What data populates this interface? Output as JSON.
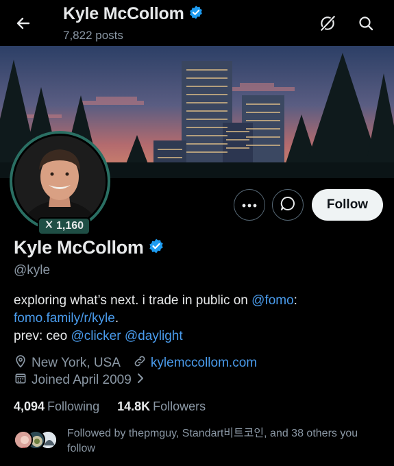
{
  "header": {
    "name": "Kyle McCollom",
    "posts": "7,822 posts",
    "back_icon": "arrow-left-icon",
    "grok_icon": "grok-icon",
    "search_icon": "search-icon"
  },
  "profile": {
    "affiliate_count": "1,160",
    "name": "Kyle McCollom",
    "handle": "@kyle",
    "verified": true,
    "accent_color": "#1d9bf0"
  },
  "actions": {
    "more_icon": "more-icon",
    "message_icon": "message-icon",
    "follow_label": "Follow"
  },
  "bio": {
    "line1_text": "exploring what’s next. i trade in public on ",
    "line1_mention": "@fomo",
    "line1_suffix": ":",
    "line2_link": "fomo.family/r/kyle",
    "line2_suffix": ".",
    "line3_text": "prev: ceo ",
    "line3_mention1": "@clicker",
    "line3_mention2": "@daylight"
  },
  "meta": {
    "location": "New York, USA",
    "website": "kylemccollom.com",
    "joined": "Joined April 2009"
  },
  "stats": {
    "following_count": "4,094",
    "following_label": "Following",
    "followers_count": "14.8K",
    "followers_label": "Followers"
  },
  "followed_by": {
    "text": "Followed by thepmguy, Standart비트코인, and 38 others you follow"
  }
}
